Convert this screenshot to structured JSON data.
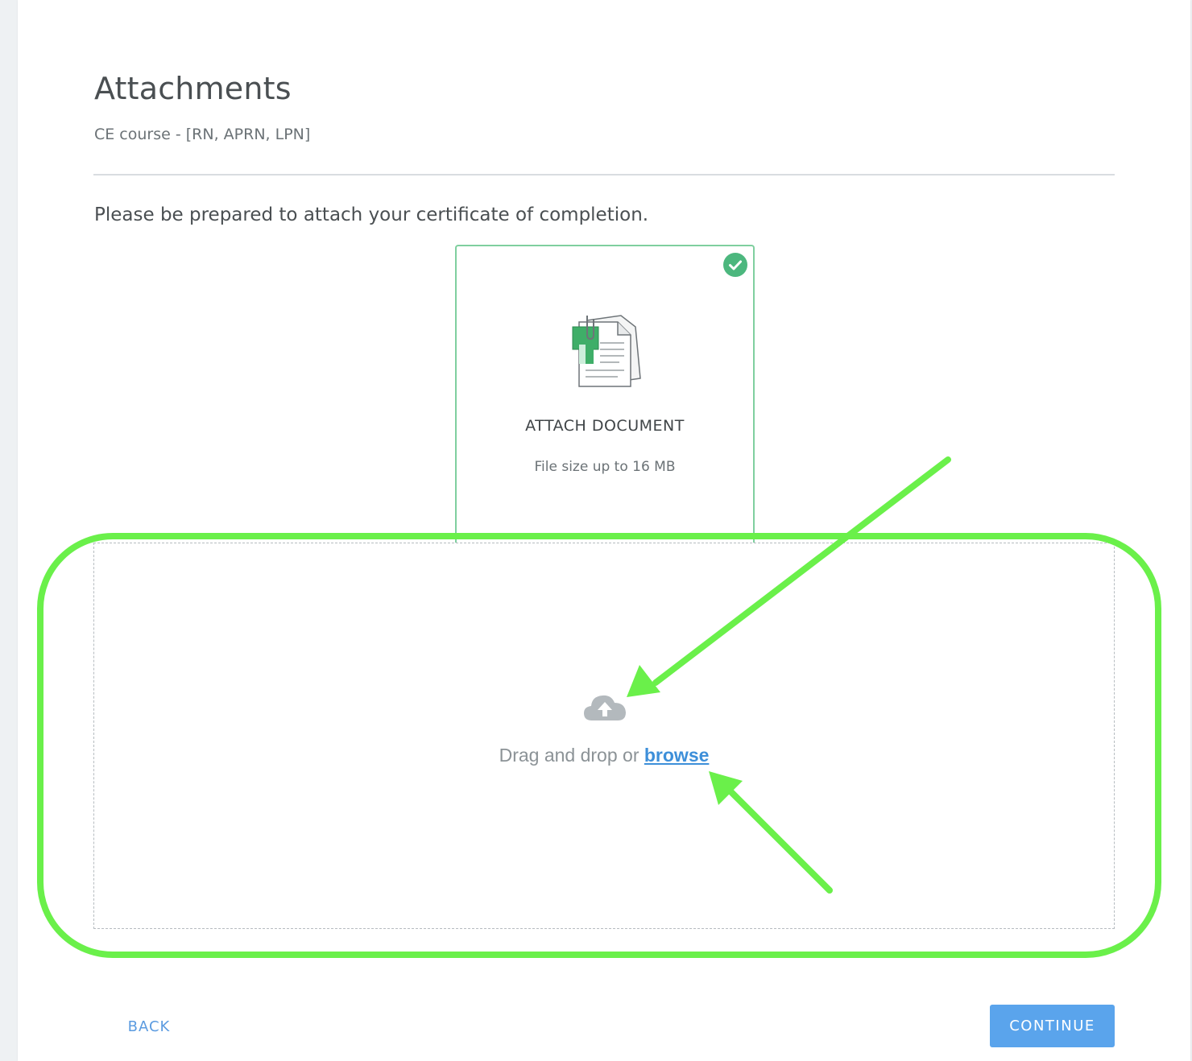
{
  "page": {
    "title": "Attachments",
    "subtitle": "CE course - [RN, APRN, LPN]",
    "instructions": "Please be prepared to attach your certificate of completion."
  },
  "attach_card": {
    "title": "ATTACH DOCUMENT",
    "note": "File size up to 16 MB",
    "status_icon": "check-circle-icon",
    "illustration_icon": "document-with-clip-icon"
  },
  "dropzone": {
    "icon": "cloud-upload-icon",
    "text": "Drag and drop or",
    "browse_label": "browse"
  },
  "footer": {
    "back_label": "BACK",
    "continue_label": "CONTINUE"
  },
  "colors": {
    "accent_blue": "#5aa4ec",
    "link_blue": "#3d8fd9",
    "success_green": "#4cb77e",
    "annotation_green": "#6af04a"
  }
}
